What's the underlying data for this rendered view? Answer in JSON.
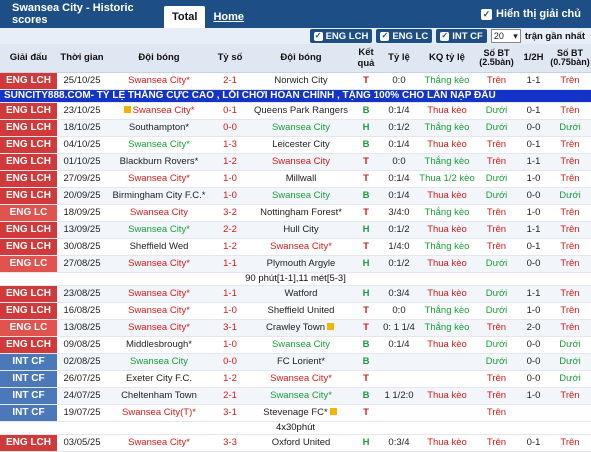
{
  "header": {
    "title": "Swansea City - Historic scores",
    "tab_total": "Total",
    "tab_home": "Home",
    "show_all_label": "Hiển thị giải chủ",
    "show_all_check": "✓"
  },
  "filters": {
    "chips": [
      "ENG LCH",
      "ENG LC",
      "INT CF"
    ],
    "check": "✓",
    "count_value": "20",
    "count_arrow": "▾",
    "count_label": "trận gần nhất"
  },
  "columns": [
    "Giải đấu",
    "Thời gian",
    "Đội bóng",
    "Tỷ số",
    "Đội bóng",
    "Kết quả",
    "Tỷ lệ",
    "KQ tỷ lệ",
    "Số BT (2.5bàn)",
    "1/2H",
    "Số BT (0.75bàn)"
  ],
  "banner_text": "SUNCITY888.COM- TỶ LỆ THẮNG CỰC CAO , LỖI CHƠI HOÀN CHỈNH , TẶNG 100% CHO LẦN NẠP ĐẦU",
  "note_text": "90 phút[1-1],11 mét[5-3]",
  "note_text2": "4x30phút",
  "rows": [
    {
      "comp": "ENG LCH",
      "cc": "lch",
      "date": "25/10/25",
      "home": "Swansea City*",
      "hc": "sw",
      "score": "2-1",
      "away": "Norwich City",
      "ac": "",
      "res": "T",
      "rc": "tcol",
      "hdp": "0:0",
      "hr": "Thắng kèo",
      "hrc": "win",
      "ou": "Trên",
      "ouc": "tren",
      "h1": "1-1",
      "ou2": "Trên",
      "ou2c": "tren"
    },
    {
      "comp": "ENG LCH",
      "cc": "lch",
      "date": "23/10/25",
      "home": "Swansea City*",
      "hc": "sw",
      "flag": true,
      "score": "0-1",
      "away": "Queens Park Rangers",
      "ac": "",
      "res": "B",
      "rc": "bcol",
      "hdp": "0:1/4",
      "hr": "Thua kèo",
      "hrc": "lose",
      "ou": "Dưới",
      "ouc": "duoi",
      "h1": "0-1",
      "ou2": "Trên",
      "ou2c": "tren"
    },
    {
      "comp": "ENG LCH",
      "cc": "lch",
      "date": "18/10/25",
      "home": "Southampton*",
      "hc": "",
      "score": "0-0",
      "away": "Swansea City",
      "ac": "home-g",
      "res": "H",
      "rc": "hcol",
      "hdp": "0:1/2",
      "hr": "Thắng kèo",
      "hrc": "win",
      "ou": "Dưới",
      "ouc": "duoi",
      "h1": "0-0",
      "ou2": "Dưới",
      "ou2c": "duoi"
    },
    {
      "comp": "ENG LCH",
      "cc": "lch",
      "date": "04/10/25",
      "home": "Swansea City*",
      "hc": "home-g",
      "score": "1-3",
      "away": "Leicester City",
      "ac": "",
      "res": "B",
      "rc": "bcol",
      "hdp": "0:1/4",
      "hr": "Thua kèo",
      "hrc": "lose",
      "ou": "Trên",
      "ouc": "tren",
      "h1": "0-1",
      "ou2": "Trên",
      "ou2c": "tren"
    },
    {
      "comp": "ENG LCH",
      "cc": "lch",
      "date": "01/10/25",
      "home": "Blackburn Rovers*",
      "hc": "",
      "score": "1-2",
      "away": "Swansea City",
      "ac": "away-t",
      "res": "T",
      "rc": "tcol",
      "hdp": "0:0",
      "hr": "Thắng kèo",
      "hrc": "win",
      "ou": "Trên",
      "ouc": "tren",
      "h1": "1-1",
      "ou2": "Trên",
      "ou2c": "tren"
    },
    {
      "comp": "ENG LCH",
      "cc": "lch",
      "date": "27/09/25",
      "home": "Swansea City*",
      "hc": "sw",
      "score": "1-0",
      "away": "Millwall",
      "ac": "",
      "res": "T",
      "rc": "tcol",
      "hdp": "0:1/4",
      "hr": "Thua 1/2 kèo",
      "hrc": "win",
      "ou": "Dưới",
      "ouc": "duoi",
      "h1": "1-0",
      "ou2": "Trên",
      "ou2c": "tren"
    },
    {
      "comp": "ENG LCH",
      "cc": "lch",
      "date": "20/09/25",
      "home": "Birmingham City F.C.*",
      "hc": "",
      "score": "1-0",
      "away": "Swansea City",
      "ac": "home-g",
      "res": "B",
      "rc": "bcol",
      "hdp": "0:1/4",
      "hr": "Thua kèo",
      "hrc": "lose",
      "ou": "Dưới",
      "ouc": "duoi",
      "h1": "0-0",
      "ou2": "Dưới",
      "ou2c": "duoi"
    },
    {
      "comp": "ENG LC",
      "cc": "lc",
      "date": "18/09/25",
      "home": "Swansea City",
      "hc": "sw",
      "score": "3-2",
      "away": "Nottingham Forest*",
      "ac": "",
      "res": "T",
      "rc": "tcol",
      "hdp": "3/4:0",
      "hr": "Thắng kèo",
      "hrc": "win",
      "ou": "Trên",
      "ouc": "tren",
      "h1": "1-0",
      "ou2": "Trên",
      "ou2c": "tren"
    },
    {
      "comp": "ENG LCH",
      "cc": "lch",
      "date": "13/09/25",
      "home": "Swansea City*",
      "hc": "home-g",
      "score": "2-2",
      "away": "Hull City",
      "ac": "",
      "res": "H",
      "rc": "hcol",
      "hdp": "0:1/2",
      "hr": "Thua kèo",
      "hrc": "lose",
      "ou": "Trên",
      "ouc": "tren",
      "h1": "1-1",
      "ou2": "Trên",
      "ou2c": "tren"
    },
    {
      "comp": "ENG LCH",
      "cc": "lch",
      "date": "30/08/25",
      "home": "Sheffield Wed",
      "hc": "",
      "score": "1-2",
      "away": "Swansea City*",
      "ac": "away-t",
      "res": "T",
      "rc": "tcol",
      "hdp": "1/4:0",
      "hr": "Thắng kèo",
      "hrc": "win",
      "ou": "Trên",
      "ouc": "tren",
      "h1": "0-1",
      "ou2": "Trên",
      "ou2c": "tren"
    },
    {
      "comp": "ENG LC",
      "cc": "lc",
      "date": "27/08/25",
      "home": "Swansea City*",
      "hc": "sw",
      "score": "1-1",
      "away": "Plymouth Argyle",
      "ac": "",
      "res": "H",
      "rc": "hcol",
      "hdp": "0:1/2",
      "hr": "Thua kèo",
      "hrc": "lose",
      "ou": "Dưới",
      "ouc": "duoi",
      "h1": "0-0",
      "ou2": "Trên",
      "ou2c": "tren",
      "note": true
    },
    {
      "comp": "ENG LCH",
      "cc": "lch",
      "date": "23/08/25",
      "home": "Swansea City*",
      "hc": "sw",
      "score": "1-1",
      "away": "Watford",
      "ac": "",
      "res": "H",
      "rc": "hcol",
      "hdp": "0:3/4",
      "hr": "Thua kèo",
      "hrc": "lose",
      "ou": "Dưới",
      "ouc": "duoi",
      "h1": "1-1",
      "ou2": "Trên",
      "ou2c": "tren"
    },
    {
      "comp": "ENG LCH",
      "cc": "lch",
      "date": "16/08/25",
      "home": "Swansea City*",
      "hc": "sw",
      "score": "1-0",
      "away": "Sheffield United",
      "ac": "",
      "res": "T",
      "rc": "tcol",
      "hdp": "0:0",
      "hr": "Thắng kèo",
      "hrc": "win",
      "ou": "Dưới",
      "ouc": "duoi",
      "h1": "1-0",
      "ou2": "Trên",
      "ou2c": "tren"
    },
    {
      "comp": "ENG LC",
      "cc": "lc",
      "date": "13/08/25",
      "home": "Swansea City*",
      "hc": "sw",
      "score": "3-1",
      "away": "Crawley Town",
      "ac": "",
      "flag2": true,
      "res": "T",
      "rc": "tcol",
      "hdp": "0: 1 1/4",
      "hr": "Thắng kèo",
      "hrc": "win",
      "ou": "Trên",
      "ouc": "tren",
      "h1": "2-0",
      "ou2": "Trên",
      "ou2c": "tren"
    },
    {
      "comp": "ENG LCH",
      "cc": "lch",
      "date": "09/08/25",
      "home": "Middlesbrough*",
      "hc": "",
      "score": "1-0",
      "away": "Swansea City",
      "ac": "home-g",
      "res": "B",
      "rc": "bcol",
      "hdp": "0:1/4",
      "hr": "Thua kèo",
      "hrc": "lose",
      "ou": "Dưới",
      "ouc": "duoi",
      "h1": "0-0",
      "ou2": "Dưới",
      "ou2c": "duoi"
    },
    {
      "comp": "INT CF",
      "cc": "cf",
      "date": "02/08/25",
      "home": "Swansea City",
      "hc": "home-g",
      "score": "0-0",
      "away": "FC Lorient*",
      "ac": "",
      "res": "B",
      "rc": "bcol",
      "hdp": "",
      "hr": "",
      "hrc": "",
      "ou": "Dưới",
      "ouc": "duoi",
      "h1": "0-0",
      "ou2": "Dưới",
      "ou2c": "duoi"
    },
    {
      "comp": "INT CF",
      "cc": "cf",
      "date": "26/07/25",
      "home": "Exeter City F.C.",
      "hc": "",
      "score": "1-2",
      "away": "Swansea City*",
      "ac": "away-t",
      "res": "T",
      "rc": "tcol",
      "hdp": "",
      "hr": "",
      "hrc": "",
      "ou": "Trên",
      "ouc": "tren",
      "h1": "0-0",
      "ou2": "Dưới",
      "ou2c": "duoi"
    },
    {
      "comp": "INT CF",
      "cc": "cf",
      "date": "24/07/25",
      "home": "Cheltenham Town",
      "hc": "",
      "score": "2-1",
      "away": "Swansea City*",
      "ac": "home-g",
      "res": "B",
      "rc": "bcol",
      "hdp": "1 1/2:0",
      "hr": "Thua kèo",
      "hrc": "lose",
      "ou": "Trên",
      "ouc": "tren",
      "h1": "1-0",
      "ou2": "Trên",
      "ou2c": "tren"
    },
    {
      "comp": "INT CF",
      "cc": "cf",
      "date": "19/07/25",
      "home": "Swansea City(T)*",
      "hc": "sw",
      "score": "3-1",
      "away": "Stevenage FC*",
      "ac": "",
      "flag2": true,
      "res": "T",
      "rc": "tcol",
      "hdp": "",
      "hr": "",
      "hrc": "",
      "ou": "Trên",
      "ouc": "tren",
      "h1": "",
      "ou2": "",
      "ou2c": "",
      "note2": true
    },
    {
      "comp": "ENG LCH",
      "cc": "lch",
      "date": "03/05/25",
      "home": "Swansea City*",
      "hc": "sw",
      "score": "3-3",
      "away": "Oxford United",
      "ac": "",
      "res": "H",
      "rc": "hcol",
      "hdp": "0:3/4",
      "hr": "Thua kèo",
      "hrc": "lose",
      "ou": "Trên",
      "ouc": "tren",
      "h1": "0-1",
      "ou2": "Trên",
      "ou2c": "tren"
    }
  ]
}
